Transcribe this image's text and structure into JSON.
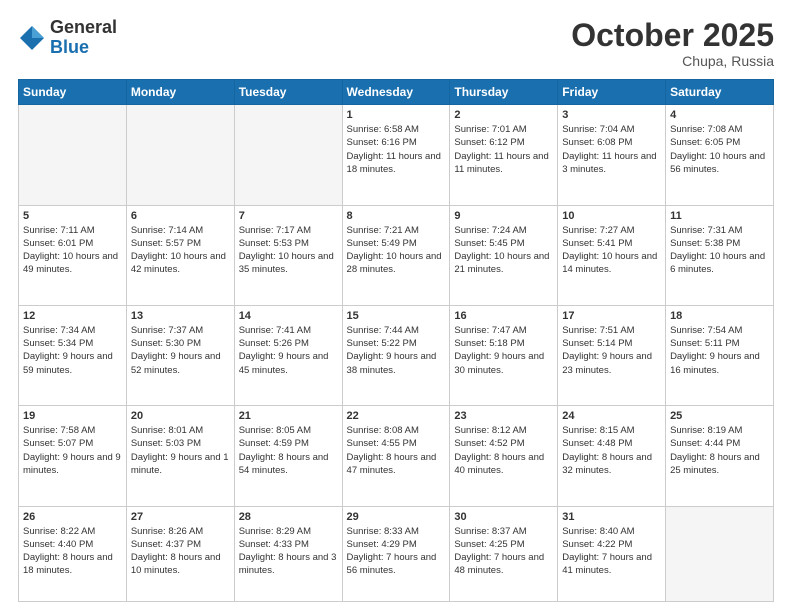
{
  "header": {
    "logo_general": "General",
    "logo_blue": "Blue",
    "month": "October 2025",
    "location": "Chupa, Russia"
  },
  "days_of_week": [
    "Sunday",
    "Monday",
    "Tuesday",
    "Wednesday",
    "Thursday",
    "Friday",
    "Saturday"
  ],
  "weeks": [
    [
      {
        "num": "",
        "empty": true
      },
      {
        "num": "",
        "empty": true
      },
      {
        "num": "",
        "empty": true
      },
      {
        "num": "1",
        "sunrise": "6:58 AM",
        "sunset": "6:16 PM",
        "daylight": "11 hours and 18 minutes."
      },
      {
        "num": "2",
        "sunrise": "7:01 AM",
        "sunset": "6:12 PM",
        "daylight": "11 hours and 11 minutes."
      },
      {
        "num": "3",
        "sunrise": "7:04 AM",
        "sunset": "6:08 PM",
        "daylight": "11 hours and 3 minutes."
      },
      {
        "num": "4",
        "sunrise": "7:08 AM",
        "sunset": "6:05 PM",
        "daylight": "10 hours and 56 minutes."
      }
    ],
    [
      {
        "num": "5",
        "sunrise": "7:11 AM",
        "sunset": "6:01 PM",
        "daylight": "10 hours and 49 minutes."
      },
      {
        "num": "6",
        "sunrise": "7:14 AM",
        "sunset": "5:57 PM",
        "daylight": "10 hours and 42 minutes."
      },
      {
        "num": "7",
        "sunrise": "7:17 AM",
        "sunset": "5:53 PM",
        "daylight": "10 hours and 35 minutes."
      },
      {
        "num": "8",
        "sunrise": "7:21 AM",
        "sunset": "5:49 PM",
        "daylight": "10 hours and 28 minutes."
      },
      {
        "num": "9",
        "sunrise": "7:24 AM",
        "sunset": "5:45 PM",
        "daylight": "10 hours and 21 minutes."
      },
      {
        "num": "10",
        "sunrise": "7:27 AM",
        "sunset": "5:41 PM",
        "daylight": "10 hours and 14 minutes."
      },
      {
        "num": "11",
        "sunrise": "7:31 AM",
        "sunset": "5:38 PM",
        "daylight": "10 hours and 6 minutes."
      }
    ],
    [
      {
        "num": "12",
        "sunrise": "7:34 AM",
        "sunset": "5:34 PM",
        "daylight": "9 hours and 59 minutes."
      },
      {
        "num": "13",
        "sunrise": "7:37 AM",
        "sunset": "5:30 PM",
        "daylight": "9 hours and 52 minutes."
      },
      {
        "num": "14",
        "sunrise": "7:41 AM",
        "sunset": "5:26 PM",
        "daylight": "9 hours and 45 minutes."
      },
      {
        "num": "15",
        "sunrise": "7:44 AM",
        "sunset": "5:22 PM",
        "daylight": "9 hours and 38 minutes."
      },
      {
        "num": "16",
        "sunrise": "7:47 AM",
        "sunset": "5:18 PM",
        "daylight": "9 hours and 30 minutes."
      },
      {
        "num": "17",
        "sunrise": "7:51 AM",
        "sunset": "5:14 PM",
        "daylight": "9 hours and 23 minutes."
      },
      {
        "num": "18",
        "sunrise": "7:54 AM",
        "sunset": "5:11 PM",
        "daylight": "9 hours and 16 minutes."
      }
    ],
    [
      {
        "num": "19",
        "sunrise": "7:58 AM",
        "sunset": "5:07 PM",
        "daylight": "9 hours and 9 minutes."
      },
      {
        "num": "20",
        "sunrise": "8:01 AM",
        "sunset": "5:03 PM",
        "daylight": "9 hours and 1 minute."
      },
      {
        "num": "21",
        "sunrise": "8:05 AM",
        "sunset": "4:59 PM",
        "daylight": "8 hours and 54 minutes."
      },
      {
        "num": "22",
        "sunrise": "8:08 AM",
        "sunset": "4:55 PM",
        "daylight": "8 hours and 47 minutes."
      },
      {
        "num": "23",
        "sunrise": "8:12 AM",
        "sunset": "4:52 PM",
        "daylight": "8 hours and 40 minutes."
      },
      {
        "num": "24",
        "sunrise": "8:15 AM",
        "sunset": "4:48 PM",
        "daylight": "8 hours and 32 minutes."
      },
      {
        "num": "25",
        "sunrise": "8:19 AM",
        "sunset": "4:44 PM",
        "daylight": "8 hours and 25 minutes."
      }
    ],
    [
      {
        "num": "26",
        "sunrise": "8:22 AM",
        "sunset": "4:40 PM",
        "daylight": "8 hours and 18 minutes."
      },
      {
        "num": "27",
        "sunrise": "8:26 AM",
        "sunset": "4:37 PM",
        "daylight": "8 hours and 10 minutes."
      },
      {
        "num": "28",
        "sunrise": "8:29 AM",
        "sunset": "4:33 PM",
        "daylight": "8 hours and 3 minutes."
      },
      {
        "num": "29",
        "sunrise": "8:33 AM",
        "sunset": "4:29 PM",
        "daylight": "7 hours and 56 minutes."
      },
      {
        "num": "30",
        "sunrise": "8:37 AM",
        "sunset": "4:25 PM",
        "daylight": "7 hours and 48 minutes."
      },
      {
        "num": "31",
        "sunrise": "8:40 AM",
        "sunset": "4:22 PM",
        "daylight": "7 hours and 41 minutes."
      },
      {
        "num": "",
        "empty": true
      }
    ]
  ]
}
